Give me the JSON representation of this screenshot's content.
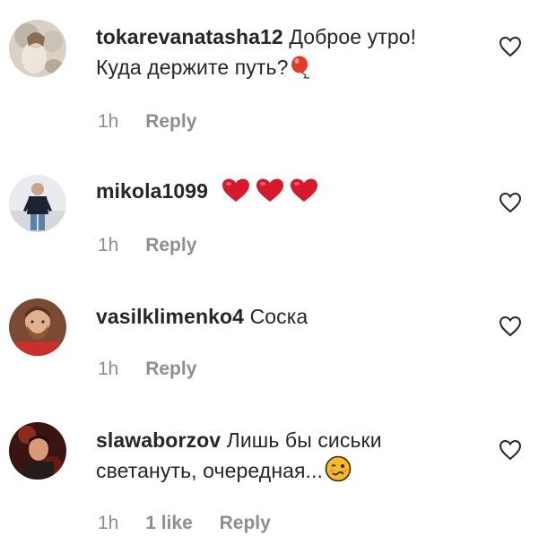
{
  "comments": [
    {
      "username": "tokarevanatasha12",
      "text_line1": "Доброе утро!",
      "text_line2": "Куда держите путь?",
      "emoji": "balloon-icon",
      "time": "1h",
      "likes": "",
      "reply": "Reply"
    },
    {
      "username": "mikola1099",
      "text_line1": "",
      "text_line2": "",
      "emoji": "red-heart-icon x3",
      "time": "1h",
      "likes": "",
      "reply": "Reply"
    },
    {
      "username": "vasilklimenko4",
      "text_line1": "Соска",
      "text_line2": "",
      "emoji": "",
      "time": "1h",
      "likes": "",
      "reply": "Reply"
    },
    {
      "username": "slawaborzov",
      "text_line1": "Лишь бы сиськи",
      "text_line2": "светануть, очередная...",
      "emoji": "woozy-face-icon",
      "time": "1h",
      "likes": "1 like",
      "reply": "Reply"
    }
  ],
  "colors": {
    "text": "#262626",
    "secondary": "#8e8e8e",
    "heart_emoji": "#d7192c",
    "emoji_face": "#f7b928"
  }
}
